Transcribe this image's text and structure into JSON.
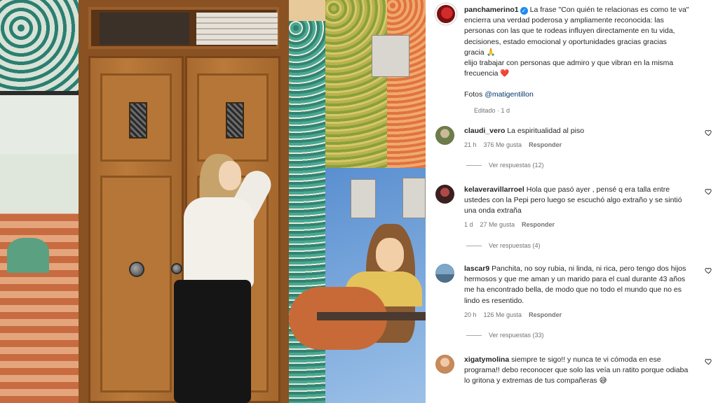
{
  "post": {
    "username": "panchamerino1",
    "caption_lines": [
      "La frase \"Con quién te relacionas es como te va\"",
      "encierra una verdad poderosa y ampliamente reconocida: las",
      "personas con las que te rodeas influyen directamente en tu vida,",
      "decisiones, estado emocional y oportunidades gracias gracias",
      "gracia 🙏",
      "elijo trabajar con personas que admiro y que vibran en la misma",
      "frecuencia ❤️"
    ],
    "photo_credit_label": "Fotos",
    "photo_credit_mention": "@matigentillon",
    "edited_meta": "Editado · 1 d"
  },
  "comments": [
    {
      "username": "claudi_vero",
      "text": "La espiritualidad al piso",
      "time": "21 h",
      "likes": "376 Me gusta",
      "reply_label": "Responder",
      "view_replies": "Ver respuestas (12)"
    },
    {
      "username": "kelaveravillarroel",
      "text": "Hola que pasó ayer , pensé q era talla entre ustedes con la Pepi pero luego se escuchó algo extraño y se sintió una onda extraña",
      "time": "1 d",
      "likes": "27 Me gusta",
      "reply_label": "Responder",
      "view_replies": "Ver respuestas (4)"
    },
    {
      "username": "lascar9",
      "text": "Panchita, no soy rubia, ni linda, ni rica, pero tengo dos hijos hermosos y que me aman y un marido para el cual durante 43 años me ha encontrado bella, de modo que no todo el mundo que no es lindo es resentido.",
      "time": "20 h",
      "likes": "126 Me gusta",
      "reply_label": "Responder",
      "view_replies": "Ver respuestas (33)"
    },
    {
      "username": "xigatymolina",
      "text": "siempre te sigo!! y nunca te vi cómoda en ese programa!! debo reconocer que solo las veía un ratito porque odiaba lo gritona y extremas de tus compañeras 😅"
    }
  ],
  "icons": {
    "verified": "verified-badge-icon",
    "heart": "heart-outline-icon"
  },
  "colors": {
    "verified": "#1d8cf2",
    "mention": "#00376b",
    "muted": "#737373"
  }
}
